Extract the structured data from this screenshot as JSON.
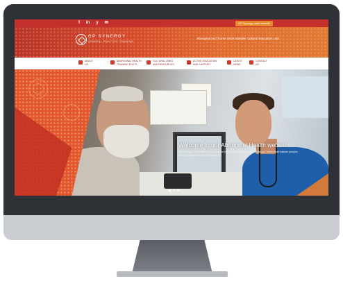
{
  "topbar": {
    "social_icons": [
      {
        "icon": "facebook-icon",
        "glyph": "f"
      },
      {
        "icon": "linkedin-icon",
        "glyph": "in"
      },
      {
        "icon": "twitter-icon",
        "glyph": "y"
      },
      {
        "icon": "email-icon",
        "glyph": "✉"
      }
    ],
    "main_site_button": "GP Synergy main website"
  },
  "header": {
    "brand": "GP SYNERGY",
    "brand_sub": "GENERAL PRACTICE TRAINING",
    "tagline": "Aboriginal and Torres Strait Islander Cultural Education Unit"
  },
  "nav": {
    "items": [
      {
        "label": "ABOUT\nUS",
        "icon": "people-icon"
      },
      {
        "label": "ABORIGINAL HEALTH\nTRAINING POSTS",
        "icon": "stethoscope-icon"
      },
      {
        "label": "CULTURAL LINKS\nAND RESOURCES",
        "icon": "book-icon"
      },
      {
        "label": "ACTIVE EDUCATION\nAND SUPPORT",
        "icon": "chat-icon"
      },
      {
        "label": "LATEST\nNEWS",
        "icon": "news-icon"
      },
      {
        "label": "CONTACT\nUS",
        "icon": "phone-icon"
      }
    ]
  },
  "hero": {
    "title": "Welcome to our Aboriginal Health website",
    "subtitle": "GP Synergy is committed to improving the health and wellbeing of Aboriginal and Torres Strait Islander peoples through education of the GP workforce.",
    "slides_total": 3,
    "slide_active": 1
  },
  "colors": {
    "brand_red": "#c5302d",
    "brand_orange": "#e06a2f",
    "button_orange": "#e88a2c",
    "monitor_bezel": "#2e3135"
  }
}
